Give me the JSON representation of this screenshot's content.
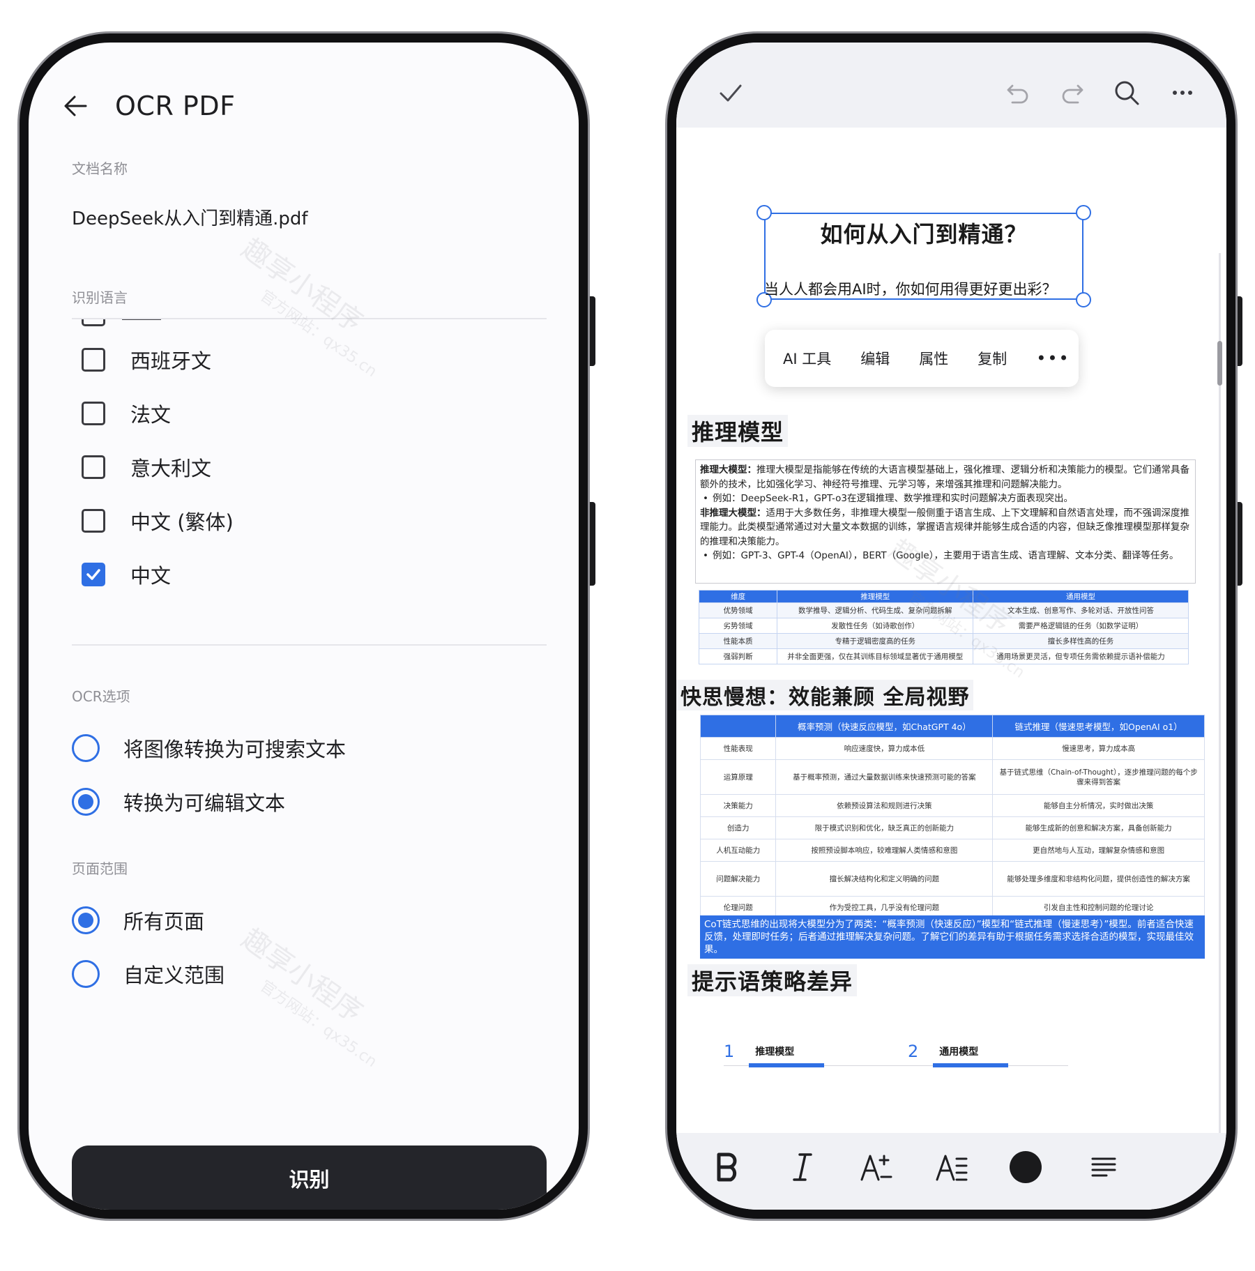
{
  "left_screen": {
    "title": "OCR PDF",
    "doc_name_label": "文档名称",
    "doc_name": "DeepSeek从入门到精通.pdf",
    "lang_label": "识别语言",
    "languages": [
      {
        "label": "西班牙文",
        "checked": false
      },
      {
        "label": "法文",
        "checked": false
      },
      {
        "label": "意大利文",
        "checked": false
      },
      {
        "label": "中文 (繁体)",
        "checked": false
      },
      {
        "label": "中文",
        "checked": true
      }
    ],
    "ocr_options_label": "OCR选项",
    "ocr_options": [
      {
        "label": "将图像转换为可搜索文本",
        "selected": false
      },
      {
        "label": "转换为可编辑文本",
        "selected": true
      }
    ],
    "page_range_label": "页面范围",
    "page_range": [
      {
        "label": "所有页面",
        "selected": true
      },
      {
        "label": "自定义范围",
        "selected": false
      }
    ],
    "action_button": "识别",
    "watermark_main": "趣享小程序",
    "watermark_sub": "官方网站：qx35.cn"
  },
  "right_screen": {
    "icons": [
      "check-icon",
      "undo-icon",
      "redo-icon",
      "search-icon",
      "more-icon"
    ],
    "doc_title": "如何从入门到精通？",
    "doc_subtitle": "当人人都会用AI时，你如何用得更好更出彩？",
    "context_menu": [
      "AI 工具",
      "编辑",
      "属性",
      "复制"
    ],
    "section1_title": "推理模型",
    "reasoning_text": {
      "p1_bold": "推理大模型：",
      "p1": "推理大模型是指能够在传统的大语言模型基础上，强化推理、逻辑分析和决策能力的模型。它们通常具备额外的技术，比如强化学习、神经符号推理、元学习等，来增强其推理和问题解决能力。",
      "b1": "例如：DeepSeek-R1，GPT-o3在逻辑推理、数学推理和实时问题解决方面表现突出。",
      "p2_bold": "非推理大模型：",
      "p2": "适用于大多数任务，非推理大模型一般侧重于语言生成、上下文理解和自然语言处理，而不强调深度推理能力。此类模型通常通过对大量文本数据的训练，掌握语言规律并能够生成合适的内容，但缺乏像推理模型那样复杂的推理和决策能力。",
      "b2": "例如：GPT-3、GPT-4（OpenAI），BERT（Google），主要用于语言生成、语言理解、文本分类、翻译等任务。"
    },
    "table1": {
      "headers": [
        "维度",
        "推理模型",
        "通用模型"
      ],
      "rows": [
        [
          "优势领域",
          "数学推导、逻辑分析、代码生成、复杂问题拆解",
          "文本生成、创意写作、多轮对话、开放性问答"
        ],
        [
          "劣势领域",
          "发散性任务（如诗歌创作）",
          "需要严格逻辑链的任务（如数学证明）"
        ],
        [
          "性能本质",
          "专精于逻辑密度高的任务",
          "擅长多样性高的任务"
        ],
        [
          "强弱判断",
          "并非全面更强，仅在其训练目标领域显著优于通用模型",
          "通用场景更灵活，但专项任务需依赖提示语补偿能力"
        ]
      ]
    },
    "section2_title": "快思慢想：效能兼顾 全局视野",
    "table2": {
      "headers": [
        "",
        "概率预测（快速反应模型，如ChatGPT 4o）",
        "链式推理（慢速思考模型，如OpenAI o1）"
      ],
      "rows": [
        [
          "性能表现",
          "响应速度快，算力成本低",
          "慢速思考，算力成本高"
        ],
        [
          "运算原理",
          "基于概率预测，通过大量数据训练来快速预测可能的答案",
          "基于链式思维（Chain-of-Thought），逐步推理问题的每个步骤来得到答案"
        ],
        [
          "决策能力",
          "依赖预设算法和规则进行决策",
          "能够自主分析情况，实时做出决策"
        ],
        [
          "创造力",
          "限于模式识别和优化，缺乏真正的创新能力",
          "能够生成新的创意和解决方案，具备创新能力"
        ],
        [
          "人机互动能力",
          "按照预设脚本响应，较难理解人类情感和意图",
          "更自然地与人互动，理解复杂情感和意图"
        ],
        [
          "问题解决能力",
          "擅长解决结构化和定义明确的问题",
          "能够处理多维度和非结构化问题，提供创造性的解决方案"
        ],
        [
          "伦理问题",
          "作为受控工具，几乎没有伦理问题",
          "引发自主性和控制问题的伦理讨论"
        ]
      ],
      "note": "CoT链式思维的出现将大模型分为了两类：“概率预测（快速反应）”模型和“链式推理（慢速思考）”模型。前者适合快速反馈，处理即时任务；后者通过推理解决复杂问题。了解它们的差异有助于根据任务需求选择合适的模型，实现最佳效果。"
    },
    "section3_title": "提示语策略差异",
    "bottom_tabs": [
      {
        "num": "1",
        "label": "推理模型"
      },
      {
        "num": "2",
        "label": "通用模型"
      }
    ],
    "format_icons": [
      "bold-icon",
      "italic-icon",
      "font-size-increase-icon",
      "text-spacing-icon",
      "color-icon",
      "align-icon"
    ],
    "accent_color": "#2f6fe4"
  }
}
